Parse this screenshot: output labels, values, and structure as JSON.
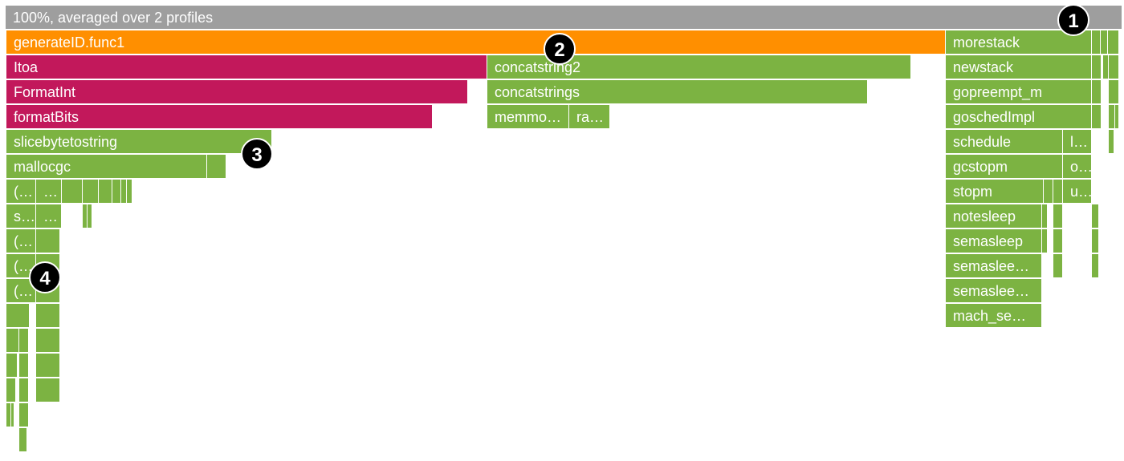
{
  "root_label": "100%, averaged over 2 profiles",
  "colors": {
    "root": "#9e9e9e",
    "orange": "#ff8f00",
    "red": "#c2185b",
    "green": "#7cb342"
  },
  "frames": {
    "generateID": "generateID.func1",
    "itoa": "Itoa",
    "formatint": "FormatInt",
    "formatbits": "formatBits",
    "slicebyte": "slicebytetostring",
    "mallocgc": "mallocgc",
    "concatstring2": "concatstring2",
    "concatstrings": "concatstrings",
    "memmove": "memmo…",
    "rawstring": "ra…",
    "morestack": "morestack",
    "newstack": "newstack",
    "gopreempt": "gopreempt_m",
    "goschedimpl": "goschedImpl",
    "schedule": "schedule",
    "gcstopm": "gcstopm",
    "stopm": "stopm",
    "notesleep": "notesleep",
    "semasleep": "semasleep",
    "semasleep2": "semaslee…",
    "semasleep3": "semaslee…",
    "mach_se": "mach_se…",
    "l_small": "l…",
    "o_small": "o…",
    "u_small": "u…",
    "mal_a": "(…",
    "mal_b": "…",
    "mal_c": "s…",
    "mal_d": "…",
    "mal_e": "(…",
    "mal_f": "(…",
    "mal_g": "(…"
  },
  "badges": [
    "1",
    "2",
    "3",
    "4"
  ]
}
